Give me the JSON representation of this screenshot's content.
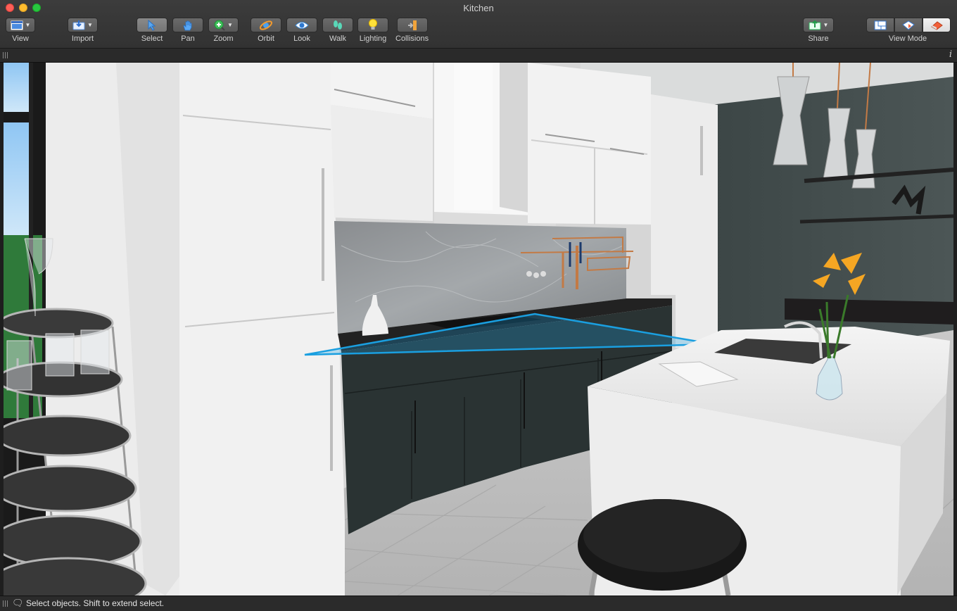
{
  "window": {
    "title": "Kitchen"
  },
  "toolbar": {
    "view": "View",
    "import": "Import",
    "select": "Select",
    "pan": "Pan",
    "zoom": "Zoom",
    "orbit": "Orbit",
    "look": "Look",
    "walk": "Walk",
    "lighting": "Lighting",
    "collisions": "Collisions",
    "share": "Share",
    "view_mode": "View Mode"
  },
  "view_mode_options": [
    "2D plan",
    "3D plan",
    "3D view"
  ],
  "view_mode_selected": "3D view",
  "icons": [
    "view-icon",
    "import-icon",
    "cursor-icon",
    "hand-icon",
    "zoom-plus-icon",
    "orbit-icon",
    "eye-icon",
    "footsteps-icon",
    "lightbulb-icon",
    "collisions-icon",
    "share-icon",
    "plan-2d-icon",
    "plan-3d-icon",
    "view-3d-icon",
    "info-icon",
    "speech-bubble-icon"
  ],
  "colors": {
    "accent_selection": "#1a9fe0",
    "toolbar_bg": "#3a3a3a"
  },
  "status": {
    "message": "Select objects. Shift to extend select."
  }
}
